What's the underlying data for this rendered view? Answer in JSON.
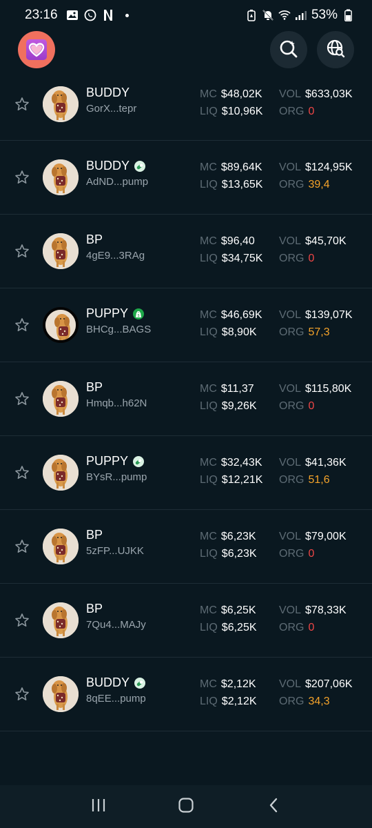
{
  "status_bar": {
    "time": "23:16",
    "battery": "53%",
    "icons": [
      "gallery-icon",
      "whatsapp-icon",
      "netflix-icon",
      "battery-saver-icon",
      "mute-icon",
      "wifi-icon",
      "signal-icon",
      "battery-icon"
    ]
  },
  "header": {
    "logo_icon": "heart-icon",
    "search_icon": "search-sparkle-icon",
    "globe_icon": "globe-search-icon"
  },
  "tokens": [
    {
      "name": "BUDDY",
      "address": "GorX...tepr",
      "badge": "",
      "mc": "$48,02K",
      "liq": "$10,96K",
      "vol": "$633,03K",
      "org": "0",
      "org_color": "red"
    },
    {
      "name": "BUDDY",
      "address": "AdND...pump",
      "badge": "pill",
      "mc": "$89,64K",
      "liq": "$13,65K",
      "vol": "$124,95K",
      "org": "39,4",
      "org_color": "orange"
    },
    {
      "name": "BP",
      "address": "4gE9...3RAg",
      "badge": "",
      "mc": "$96,40",
      "liq": "$34,75K",
      "vol": "$45,70K",
      "org": "0",
      "org_color": "red"
    },
    {
      "name": "PUPPY",
      "address": "BHCg...BAGS",
      "badge": "bag",
      "mc": "$46,69K",
      "liq": "$8,90K",
      "vol": "$139,07K",
      "org": "57,3",
      "org_color": "orange"
    },
    {
      "name": "BP",
      "address": "Hmqb...h62N",
      "badge": "",
      "mc": "$11,37",
      "liq": "$9,26K",
      "vol": "$115,80K",
      "org": "0",
      "org_color": "red"
    },
    {
      "name": "PUPPY",
      "address": "BYsR...pump",
      "badge": "pill",
      "mc": "$32,43K",
      "liq": "$12,21K",
      "vol": "$41,36K",
      "org": "51,6",
      "org_color": "orange"
    },
    {
      "name": "BP",
      "address": "5zFP...UJKK",
      "badge": "",
      "mc": "$6,23K",
      "liq": "$6,23K",
      "vol": "$79,00K",
      "org": "0",
      "org_color": "red"
    },
    {
      "name": "BP",
      "address": "7Qu4...MAJy",
      "badge": "",
      "mc": "$6,25K",
      "liq": "$6,25K",
      "vol": "$78,33K",
      "org": "0",
      "org_color": "red"
    },
    {
      "name": "BUDDY",
      "address": "8qEE...pump",
      "badge": "pill",
      "mc": "$2,12K",
      "liq": "$2,12K",
      "vol": "$207,06K",
      "org": "34,3",
      "org_color": "orange"
    }
  ],
  "labels": {
    "mc": "MC",
    "liq": "LIQ",
    "vol": "VOL",
    "org": "ORG"
  },
  "colors": {
    "background": "#0a1820",
    "red": "#ef4646",
    "orange": "#f5a32a",
    "label_gray": "#5d6b74"
  },
  "nav_bar": {
    "recents_icon": "recents-icon",
    "home_icon": "home-icon",
    "back_icon": "back-icon"
  }
}
